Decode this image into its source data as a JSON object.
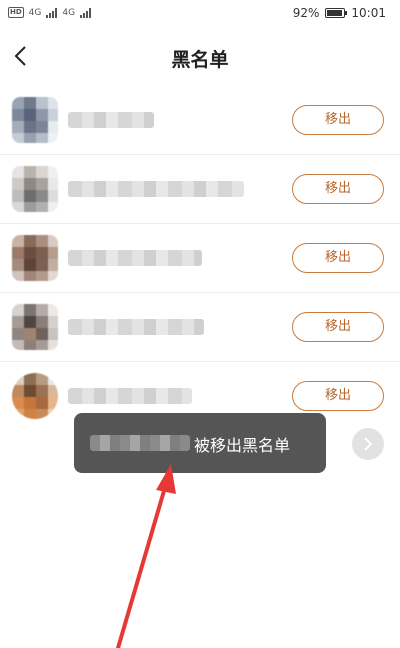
{
  "status_bar": {
    "hd_label": "HD",
    "network_1": "4G",
    "network_2": "4G",
    "battery_percent": "92%",
    "battery_level": 0.92,
    "time": "10:01"
  },
  "header": {
    "title": "黑名单",
    "back_icon": "chevron-left-icon"
  },
  "blocked_list": {
    "items": [
      {
        "remove_label": "移出"
      },
      {
        "remove_label": "移出"
      },
      {
        "remove_label": "移出"
      },
      {
        "remove_label": "移出"
      },
      {
        "remove_label": "移出"
      }
    ]
  },
  "toast": {
    "message": "被移出黑名单"
  },
  "fab": {
    "icon": "chevron-right-icon"
  },
  "colors": {
    "accent": "#c97a3c",
    "accent_text": "#b8662c",
    "toast_bg": "#464646",
    "arrow": "#e53935"
  }
}
